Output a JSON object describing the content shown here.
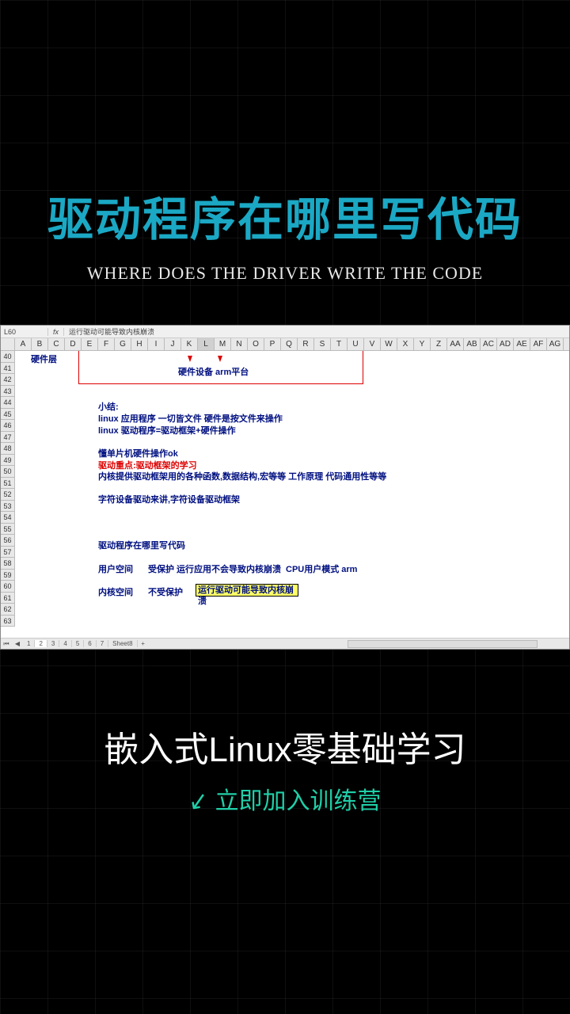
{
  "titles": {
    "main": "驱动程序在哪里写代码",
    "sub": "WHERE DOES THE DRIVER WRITE THE CODE",
    "bottom_main": "嵌入式Linux零基础学习",
    "bottom_sub": "立即加入训练营"
  },
  "formula_bar": {
    "cell_ref": "L60",
    "content": "运行驱动可能导致内核崩溃"
  },
  "columns": [
    "A",
    "B",
    "C",
    "D",
    "E",
    "F",
    "G",
    "H",
    "I",
    "J",
    "K",
    "L",
    "M",
    "N",
    "O",
    "P",
    "Q",
    "R",
    "S",
    "T",
    "U",
    "V",
    "W",
    "X",
    "Y",
    "Z",
    "AA",
    "AB",
    "AC",
    "AD",
    "AE",
    "AF",
    "AG"
  ],
  "selected_col": "L",
  "rows": [
    "40",
    "41",
    "42",
    "43",
    "44",
    "45",
    "46",
    "47",
    "48",
    "49",
    "50",
    "51",
    "52",
    "53",
    "54",
    "55",
    "56",
    "57",
    "58",
    "59",
    "60",
    "61",
    "62",
    "63"
  ],
  "hardware": {
    "label": "硬件层",
    "text": "硬件设备   arm平台"
  },
  "content": {
    "summary_title": "小结:",
    "line1": "linux 应用程序 一切皆文件  硬件是按文件来操作",
    "line2": "linux 驱动程序=驱动框架+硬件操作",
    "line3": "懂单片机硬件操作ok",
    "line4": "驱动重点:驱动框架的学习",
    "line5": "内核提供驱动框架用的各种函数,数据结构,宏等等 工作原理 代码通用性等等",
    "line6": "字符设备驱动来讲,字符设备驱动框架",
    "line7": "驱动程序在哪里写代码",
    "line8a": "用户空间",
    "line8b": "受保护  运行应用不会导致内核崩溃",
    "line8c": "CPU用户模式  arm",
    "line9a": "内核空间",
    "line9b": "不受保护",
    "line9c": "运行驱动可能导致内核崩溃"
  },
  "sheet_tabs": [
    "1",
    "2",
    "3",
    "4",
    "5",
    "6",
    "7",
    "Sheet8"
  ],
  "active_tab": "2"
}
